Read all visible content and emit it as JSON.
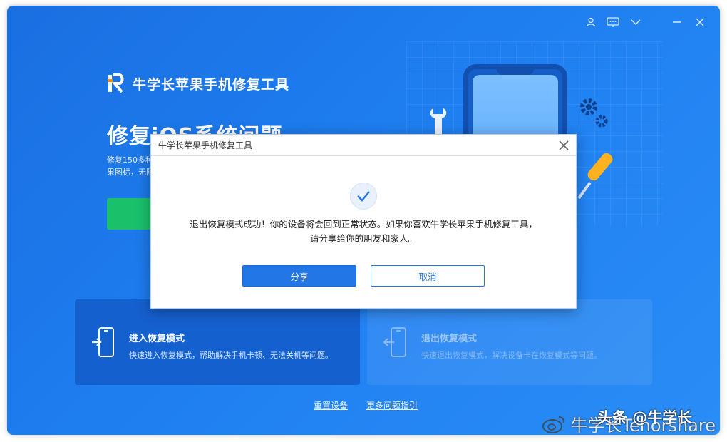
{
  "app": {
    "brand_title": "牛学长苹果手机修复工具",
    "hero_title": "修复iOS系统问题",
    "hero_desc": "修复150多种\n果图标，无限",
    "window_controls": [
      "user-icon",
      "feedback-icon",
      "chevron-down-icon",
      "minimize-icon",
      "close-icon"
    ]
  },
  "cards": [
    {
      "title": "进入恢复模式",
      "desc": "快速进入恢复模式，帮助解决手机卡顿、无法关机等问题。"
    },
    {
      "title": "退出恢复模式",
      "desc": "快速退出恢复模式，解决设备卡在恢复模式等问题。"
    }
  ],
  "footer": {
    "reset_link": "重置设备",
    "help_link": "更多问题指引"
  },
  "dialog": {
    "title": "牛学长苹果手机修复工具",
    "message_line1": "退出恢复模式成功！你的设备将会回到正常状态。如果你喜欢牛学长苹果手机修复工具，",
    "message_line2": "请分享给你的朋友和家人。",
    "share_label": "分享",
    "cancel_label": "取消"
  },
  "watermark": {
    "text": "牛学长Tenorshare",
    "overlay": "头条 @牛学长"
  },
  "colors": {
    "background": "#1e7ef0",
    "accent": "#2376e6",
    "green": "#19c16b"
  }
}
